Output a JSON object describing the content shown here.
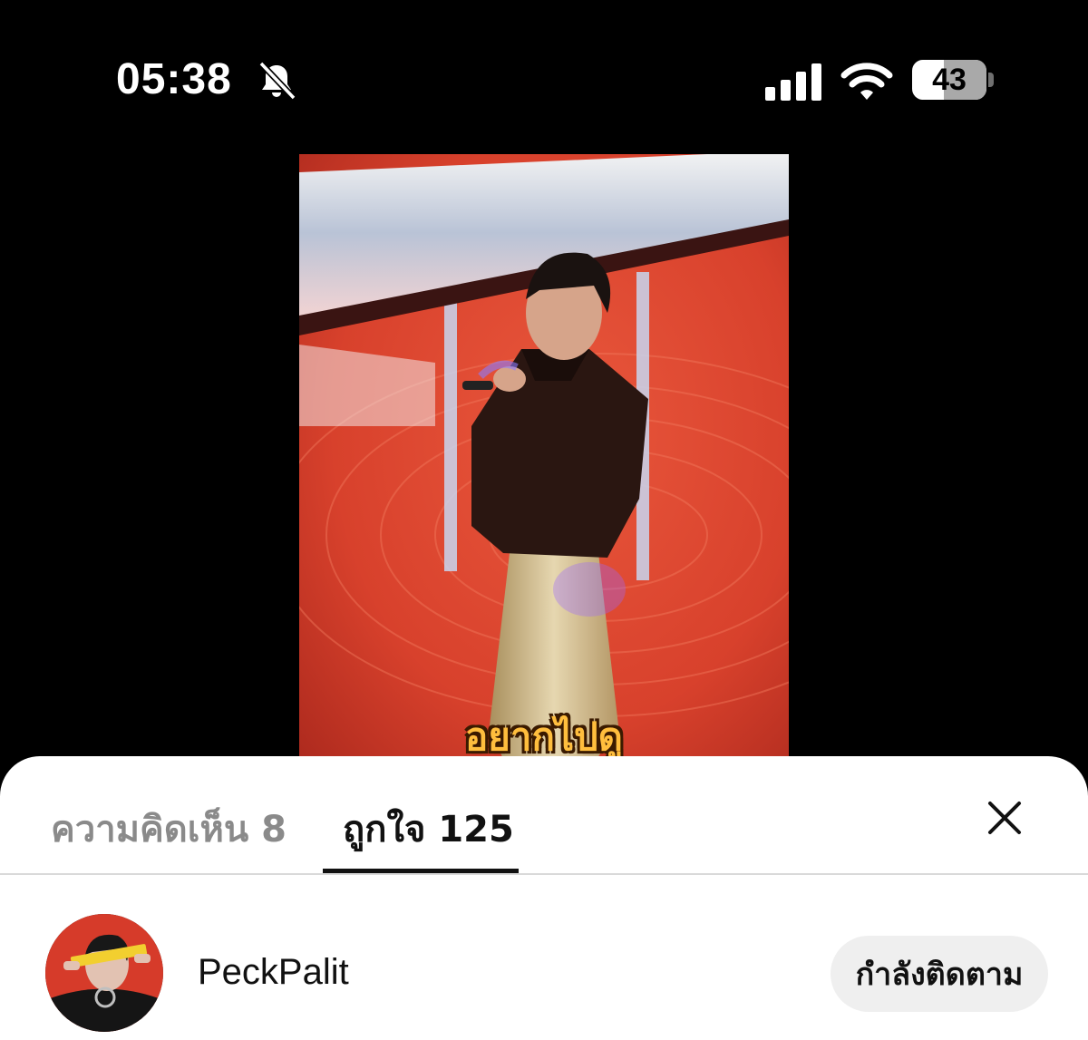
{
  "status_bar": {
    "time": "05:38",
    "battery_level": "43",
    "battery_fraction": 0.43,
    "icons": [
      "mute-icon",
      "signal-icon",
      "wifi-icon",
      "battery-icon"
    ]
  },
  "video": {
    "caption": "อยากไปดู"
  },
  "sheet": {
    "tabs": [
      {
        "label": "ความคิดเห็น 8",
        "active": false
      },
      {
        "label": "ถูกใจ 125",
        "active": true
      }
    ],
    "close_icon": "close-icon"
  },
  "likes": [
    {
      "username": "PeckPalit",
      "button_label": "กำลังติดตาม"
    }
  ],
  "colors": {
    "background": "#000000",
    "sheet": "#ffffff",
    "video_accent": "#d8412c",
    "caption": "#ffbe3d"
  }
}
